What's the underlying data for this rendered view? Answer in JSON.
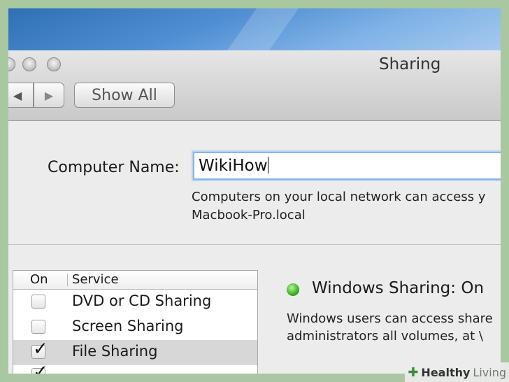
{
  "window": {
    "title": "Sharing",
    "nav": {
      "back_label": "◀",
      "forward_label": "▶",
      "show_all_label": "Show All"
    }
  },
  "computer_name": {
    "label": "Computer Name:",
    "value": "WikiHow",
    "help_line1": "Computers on your local network can access y",
    "help_line2": "Macbook-Pro.local"
  },
  "services": {
    "header_on": "On",
    "header_service": "Service",
    "items": [
      {
        "label": "DVD or CD Sharing",
        "checked": false,
        "selected": false
      },
      {
        "label": "Screen Sharing",
        "checked": false,
        "selected": false
      },
      {
        "label": "File Sharing",
        "checked": true,
        "selected": true
      }
    ]
  },
  "status": {
    "indicator_color": "#36b21e",
    "title": "Windows Sharing: On",
    "desc_line1": "Windows users can access share",
    "desc_line2": "administrators all volumes, at \\"
  },
  "watermark": {
    "brand_a": "Healthy",
    "brand_b": "Living"
  }
}
